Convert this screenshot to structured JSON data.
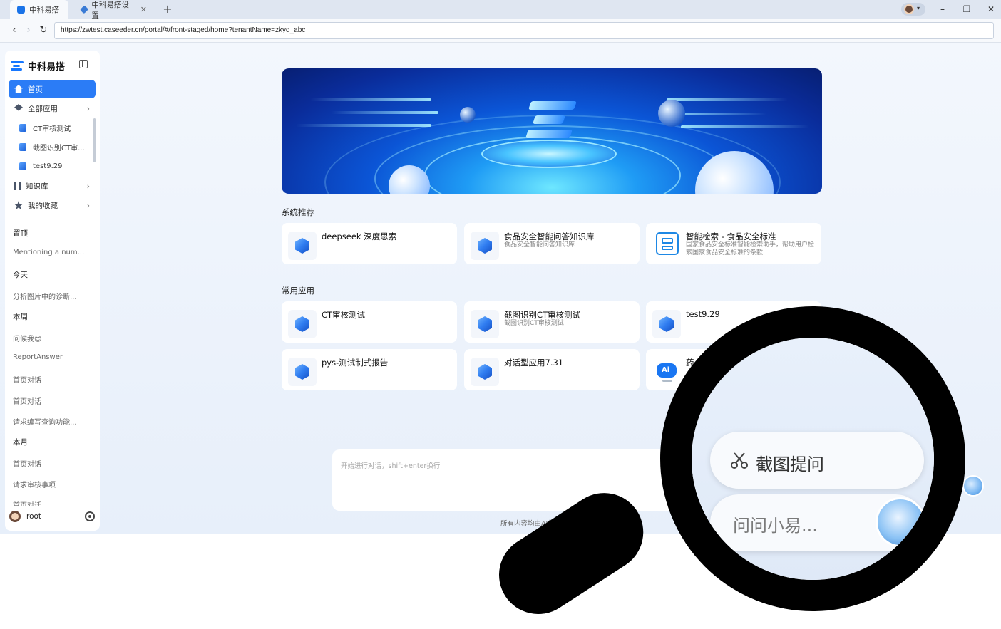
{
  "browser": {
    "tabs": [
      {
        "label": "中科易搭",
        "active": true
      },
      {
        "label": "中科易搭设置",
        "active": false
      }
    ],
    "url": "https://zwtest.caseeder.cn/portal/#/front-staged/home?tenantName=zkyd_abc",
    "new_tab": "+",
    "window_controls": {
      "minimize": "–",
      "restore": "❐",
      "close": "✕"
    }
  },
  "sidebar": {
    "brand": "中科易搭",
    "nav": [
      {
        "label": "首页",
        "icon": "home-icon",
        "active": true
      },
      {
        "label": "全部应用",
        "icon": "layers-icon"
      },
      {
        "label": "知识库",
        "icon": "books-icon"
      },
      {
        "label": "我的收藏",
        "icon": "star-icon"
      }
    ],
    "apps": [
      "CT审核测试",
      "截图识别CT审...",
      "test9.29"
    ],
    "history": [
      {
        "type": "head",
        "text": "置顶"
      },
      {
        "type": "item",
        "text": "Mentioning a num..."
      },
      {
        "type": "head",
        "text": "今天"
      },
      {
        "type": "item",
        "text": "分析图片中的诊断..."
      },
      {
        "type": "head",
        "text": "本周"
      },
      {
        "type": "item",
        "text": "问候我😊"
      },
      {
        "type": "item",
        "text": "ReportAnswer"
      },
      {
        "type": "item",
        "text": "首页对话"
      },
      {
        "type": "item",
        "text": "首页对话"
      },
      {
        "type": "item",
        "text": "请求编写查询功能..."
      },
      {
        "type": "head",
        "text": "本月"
      },
      {
        "type": "item",
        "text": "首页对话"
      },
      {
        "type": "item",
        "text": "请求审核事项"
      },
      {
        "type": "item",
        "text": "首页对话"
      }
    ],
    "user": "root"
  },
  "main": {
    "recommend_title": "系统推荐",
    "recommend": [
      {
        "title": "deepseek 深度思索",
        "desc": "",
        "icon": "cube-icon"
      },
      {
        "title": "食品安全智能问答知识库",
        "desc": "食品安全智能问答知识库",
        "icon": "cube-icon"
      },
      {
        "title": "智能检索 - 食品安全标准",
        "desc": "国家食品安全标准智能检索助手，帮助用户检索国家食品安全标准的条款",
        "icon": "document-icon"
      }
    ],
    "common_title": "常用应用",
    "common": [
      {
        "title": "CT审核测试",
        "desc": "",
        "icon": "cube-icon"
      },
      {
        "title": "截图识别CT审核测试",
        "desc": "截图识别CT审核测试",
        "icon": "cube-icon"
      },
      {
        "title": "test9.29",
        "desc": "",
        "icon": "cube-icon"
      },
      {
        "title": "pys-测试制式报告",
        "desc": "",
        "icon": "cube-icon"
      },
      {
        "title": "对话型应用7.31",
        "desc": "",
        "icon": "cube-icon"
      },
      {
        "title": "药",
        "desc": "",
        "icon": "robot-icon"
      }
    ],
    "chat_placeholder": "开始进行对话，shift+enter换行",
    "footnote": "所有内容均由AI生成，仅..."
  },
  "magnifier": {
    "screenshot_ask": "截图提问",
    "ask_xiaoyi": "问问小易..."
  },
  "colors": {
    "accent": "#2b7cf6",
    "page_bg": "#e9f0fa"
  }
}
